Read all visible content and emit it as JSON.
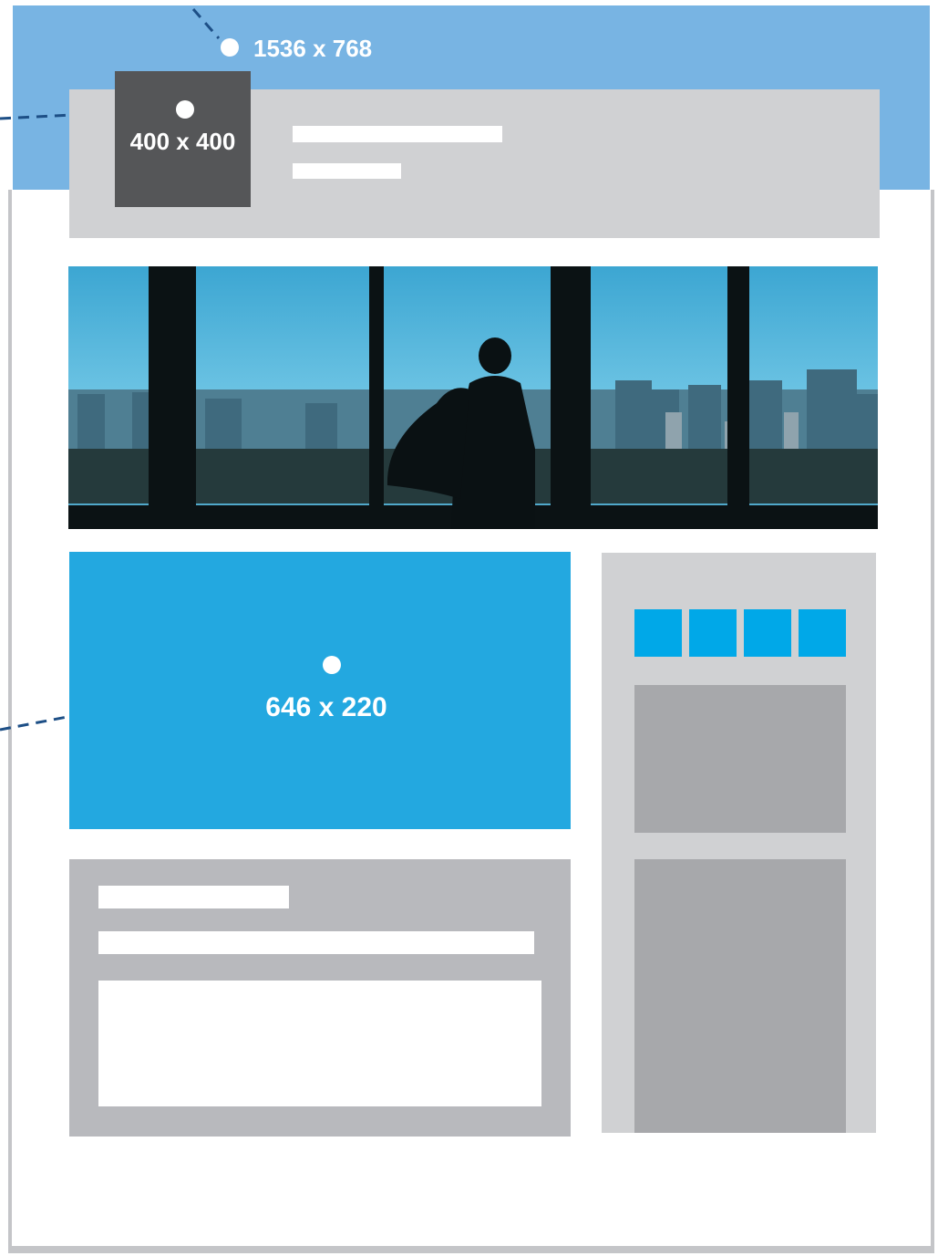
{
  "cover_photo": {
    "size_label": "1536 x 768",
    "color": "#78b4e3"
  },
  "profile_picture": {
    "size_label": "400 x 400",
    "color": "#555658"
  },
  "promo_block": {
    "size_label": "646 x 220",
    "color": "#23a8e0"
  },
  "header_bar": {
    "color": "#d0d1d3"
  },
  "sidebar": {
    "tab_count": 4,
    "tab_color": "#00a8e8"
  },
  "photo": {
    "description_icon": "city-skyline-photo"
  },
  "page_frame_color": "#c4c5c8"
}
